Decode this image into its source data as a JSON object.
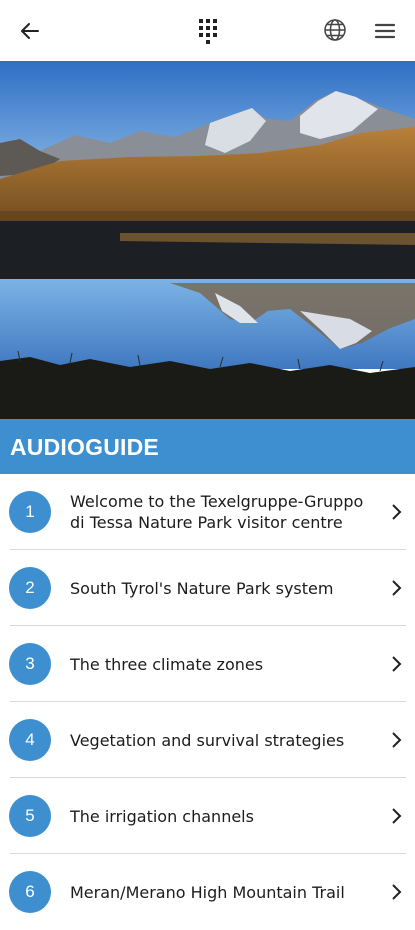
{
  "topbar": {
    "back_icon": "arrow-left-icon",
    "grid_icon": "dot-grid-icon",
    "language_icon": "globe-icon",
    "menu_icon": "hamburger-icon"
  },
  "section": {
    "title": "AUDIOGUIDE",
    "accent_color": "#3e8fd0"
  },
  "items": [
    {
      "number": "1",
      "title": "Welcome to the Texelgruppe-Gruppo di Tessa Nature Park visitor centre"
    },
    {
      "number": "2",
      "title": "South Tyrol's Nature Park system"
    },
    {
      "number": "3",
      "title": "The three climate zones"
    },
    {
      "number": "4",
      "title": "Vegetation and survival strategies"
    },
    {
      "number": "5",
      "title": "The irrigation channels"
    },
    {
      "number": "6",
      "title": "Meran/Merano High Mountain Trail"
    }
  ]
}
